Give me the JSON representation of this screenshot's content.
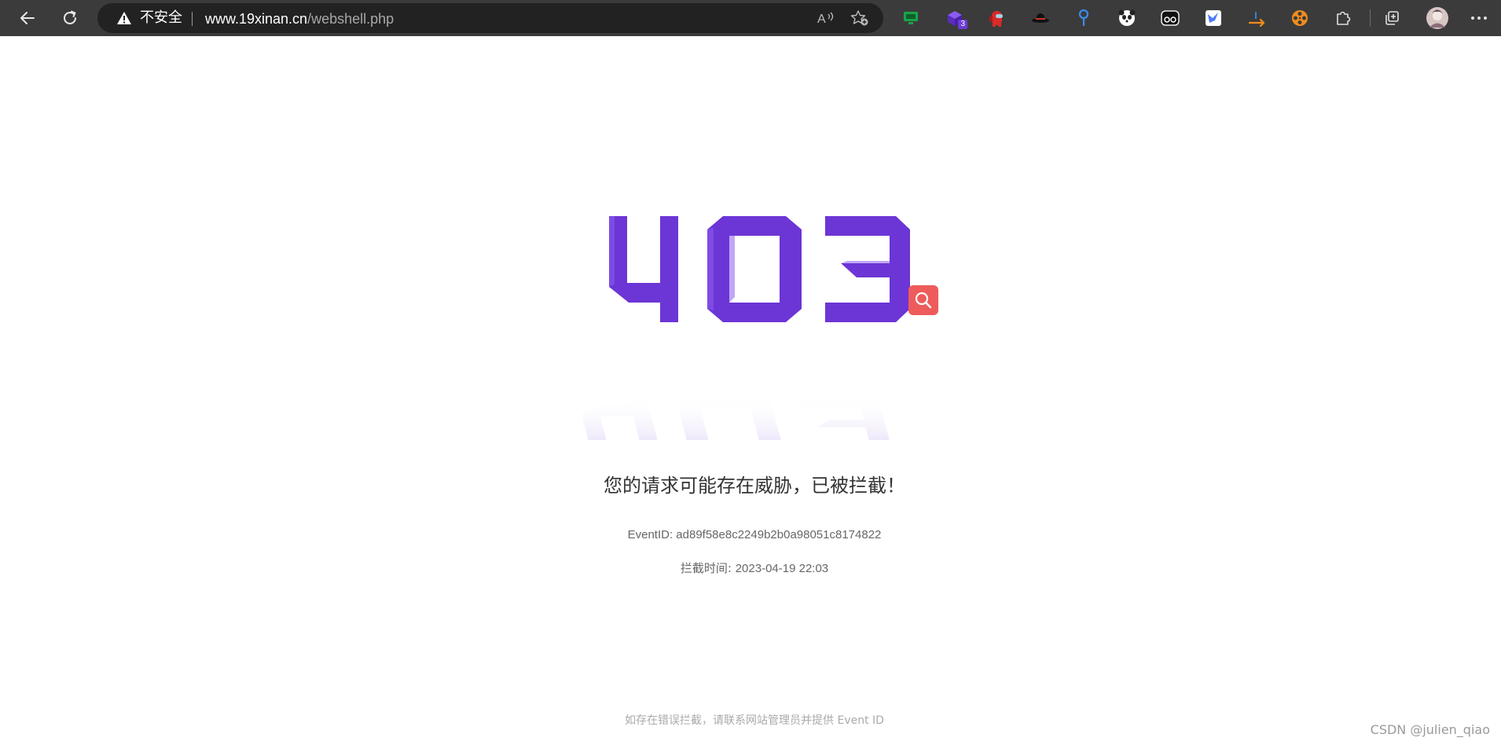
{
  "browser": {
    "security_label": "不安全",
    "url_host": "www.19xinan.cn",
    "url_path": "/webshell.php",
    "extensions": [
      {
        "icon": "monitor-extension-icon",
        "color": "#1aa34a"
      },
      {
        "icon": "cube-extension-icon",
        "color": "#6b3cd6",
        "badge": "3"
      },
      {
        "icon": "among-us-extension-icon",
        "color": "#d82a2a"
      },
      {
        "icon": "hat-extension-icon",
        "color": "#222222"
      },
      {
        "icon": "location-pin-extension-icon",
        "color": "#3b8cf0"
      },
      {
        "icon": "panda-extension-icon",
        "color": "#ffffff"
      },
      {
        "icon": "glasses-extension-icon",
        "color": "#ffffff"
      },
      {
        "icon": "bird-extension-icon",
        "color": "#4a7cf6"
      },
      {
        "icon": "arrow-extension-icon",
        "color": "#f28c1b"
      },
      {
        "icon": "film-reel-extension-icon",
        "color": "#f28c1b"
      },
      {
        "icon": "puzzle-extensions-icon",
        "color": "#e0e0e0"
      }
    ]
  },
  "page": {
    "error_code": "403",
    "headline": "您的请求可能存在威胁，已被拦截！",
    "event_id_label": "EventID:",
    "event_id_value": "ad89f58e8c2249b2b0a98051c8174822",
    "block_time_label": "拦截时间:",
    "block_time_value": "2023-04-19 22:03",
    "footer_note": "如存在错误拦截，请联系网站管理员并提供 Event ID"
  },
  "watermark": "CSDN @julien_qiao",
  "colors": {
    "accent_purple": "#6c35d6",
    "search_badge": "#ee5b5b",
    "toolbar": "#3b3b3b"
  }
}
